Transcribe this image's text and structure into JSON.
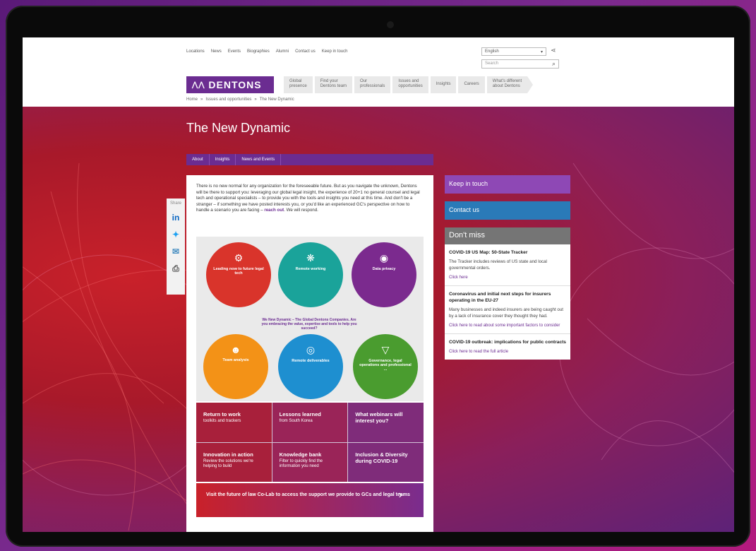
{
  "utility_nav": [
    "Locations",
    "News",
    "Events",
    "Biographies",
    "Alumni",
    "Contact us",
    "Keep in touch"
  ],
  "language": "English",
  "search_placeholder": "Search",
  "brand": "DENTONS",
  "main_nav": [
    {
      "l1": "Global",
      "l2": "presence"
    },
    {
      "l1": "Find your",
      "l2": "Dentons team"
    },
    {
      "l1": "Our",
      "l2": "professionals"
    },
    {
      "l1": "Issues and",
      "l2": "opportunities"
    },
    {
      "l1": "Insights",
      "l2": ""
    },
    {
      "l1": "Careers",
      "l2": ""
    },
    {
      "l1": "What's different",
      "l2": "about Dentons"
    }
  ],
  "breadcrumb": [
    "Home",
    "»",
    "Issues and opportunities",
    "»",
    "The New Dynamic"
  ],
  "page_title": "The New Dynamic",
  "tabs": [
    "About",
    "Insights",
    "News and Events"
  ],
  "share_label": "Share",
  "intro_text": "There is no new normal for any organization for the foreseeable future. But as you navigate the unknown, Dentons will be there to support you: leveraging our global legal insight, the experience of 20+1 no general counsel and legal tech and operational specialists – to provide you with the tools and insights you need at this time. And don't be a stranger – if something we have posted interests you, or you'd like an experienced GC's perspective on how to handle a scenario you are facing – ",
  "intro_link": "reach out",
  "intro_end": ". We will respond.",
  "infographic": {
    "caption": "We New Dynamic – The Global Dentons Companies. Are you embracing the value, expertise and tools to help you succeed?",
    "circles": [
      {
        "title": "Leading now to future legal tech",
        "color": "#d9342b"
      },
      {
        "title": "Remote working",
        "color": "#1aa39a"
      },
      {
        "title": "Data privacy",
        "color": "#7b2a8e"
      },
      {
        "title": "Team analysis",
        "color": "#f39217"
      },
      {
        "title": "Remote deliverables",
        "color": "#1e8fd0"
      },
      {
        "title": "Governance, legal operations and professional ...",
        "color": "#4a9c2f"
      }
    ]
  },
  "tiles": [
    {
      "title": "Return to work",
      "sub": "toolkits and trackers"
    },
    {
      "title": "Lessons learned",
      "sub": "from South Korea"
    },
    {
      "title": "What webinars will interest you?",
      "sub": ""
    },
    {
      "title": "Innovation in action",
      "sub": "Review the solutions we're helping to build"
    },
    {
      "title": "Knowledge bank",
      "sub": "Filter to quickly find the information you need"
    },
    {
      "title": "Inclusion & Diversity during COVID-19",
      "sub": ""
    }
  ],
  "banner": "Visit the future of law Co-Lab to access the support we provide to GCs and legal teams",
  "sidebar": {
    "keep_in_touch": "Keep in touch",
    "contact_us": "Contact us",
    "dont_miss": "Don't miss",
    "items": [
      {
        "title": "COVID-19 US Map: 50-State Tracker",
        "text": "The Tracker includes reviews of US state and local governmental orders.",
        "link": "Click here"
      },
      {
        "title": "Coronavirus and initial next steps for insurers operating in the EU-27",
        "text": "Many businesses and indeed insurers are being caught out by a lack of insurance cover they thought they had.",
        "link": "Click here to read about some important factors to consider"
      },
      {
        "title": "COVID-19 outbreak: implications for public contracts",
        "text": "",
        "link": "Click here to read the full article"
      }
    ]
  }
}
